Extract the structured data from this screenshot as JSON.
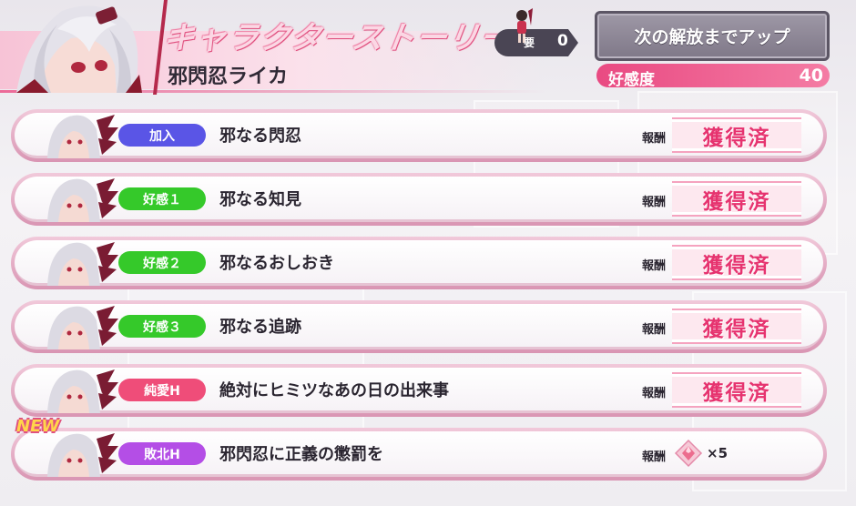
{
  "header": {
    "story_title": "キャラクターストーリー",
    "character_name": "邪閃忍ライカ",
    "key_label": "要",
    "key_count": "0",
    "unlock_button_label": "次の解放までアップ",
    "affinity_label": "好感度",
    "affinity_value": "40"
  },
  "colors": {
    "tag_blue": "#5a55e6",
    "tag_green": "#35c92a",
    "tag_pink": "#ef4d79",
    "tag_purple": "#b44ee6",
    "accent_pink": "#e94a82"
  },
  "stories": [
    {
      "tag": "加入",
      "tag_color": "#5a55e6",
      "title": "邪なる閃忍",
      "reward_label": "報酬",
      "status": "獲得済"
    },
    {
      "tag": "好感１",
      "tag_color": "#35c92a",
      "title": "邪なる知見",
      "reward_label": "報酬",
      "status": "獲得済"
    },
    {
      "tag": "好感２",
      "tag_color": "#35c92a",
      "title": "邪なるおしおき",
      "reward_label": "報酬",
      "status": "獲得済"
    },
    {
      "tag": "好感３",
      "tag_color": "#35c92a",
      "title": "邪なる追跡",
      "reward_label": "報酬",
      "status": "獲得済"
    },
    {
      "tag": "純愛H",
      "tag_color": "#ef4d79",
      "title": "絶対にヒミツなあの日の出来事",
      "reward_label": "報酬",
      "status": "獲得済"
    },
    {
      "tag": "敗北H",
      "tag_color": "#b44ee6",
      "title": "邪閃忍に正義の懲罰を",
      "reward_label": "報酬",
      "reward_icon": "crystal-gem-icon",
      "reward_count": "×5",
      "new_badge": "NEW"
    }
  ]
}
